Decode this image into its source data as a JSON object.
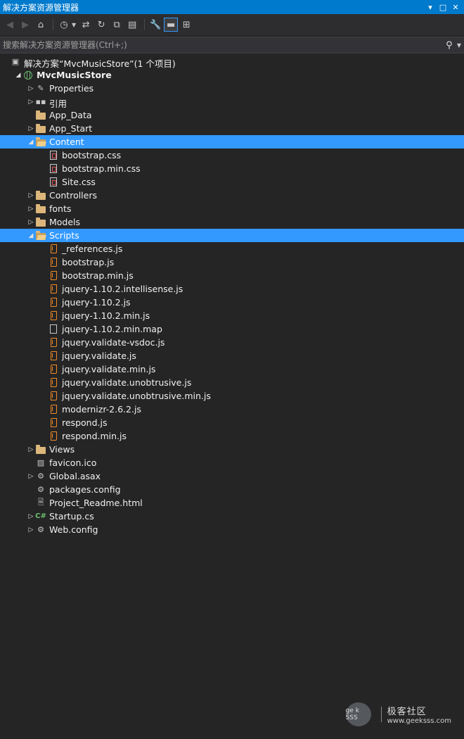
{
  "window": {
    "title": "解决方案资源管理器",
    "controls": [
      "▾",
      "□",
      "✕"
    ]
  },
  "toolbar": {
    "buttons": [
      {
        "name": "back-icon",
        "glyph": "◀",
        "disabled": true
      },
      {
        "name": "forward-icon",
        "glyph": "▶",
        "disabled": true
      },
      {
        "name": "home-icon",
        "glyph": "⌂",
        "disabled": false
      },
      {
        "name": "history-icon",
        "glyph": "◷",
        "disabled": false
      },
      {
        "name": "sync-icon",
        "glyph": "⇄",
        "disabled": false
      },
      {
        "name": "refresh-icon",
        "glyph": "↻",
        "disabled": false
      },
      {
        "name": "collapse-all-icon",
        "glyph": "⧉",
        "disabled": false
      },
      {
        "name": "show-all-files-icon",
        "glyph": "▤",
        "disabled": false
      },
      {
        "name": "properties-wrench-icon",
        "glyph": "🔧",
        "disabled": false
      },
      {
        "name": "preview-icon",
        "glyph": "▬",
        "disabled": false
      },
      {
        "name": "class-diagram-icon",
        "glyph": "⊞",
        "disabled": false
      }
    ]
  },
  "search": {
    "placeholder": "搜索解决方案资源管理器(Ctrl+;)"
  },
  "tree": [
    {
      "label": "解决方案“MvcMusicStore”(1 个项目)",
      "depth": 0,
      "expander": "none",
      "icon": "solution",
      "selected": false,
      "bold": false
    },
    {
      "label": "MvcMusicStore",
      "depth": 1,
      "expander": "open",
      "icon": "project",
      "selected": false,
      "bold": true
    },
    {
      "label": "Properties",
      "depth": 2,
      "expander": "closed",
      "icon": "wrench",
      "selected": false,
      "bold": false
    },
    {
      "label": "引用",
      "depth": 2,
      "expander": "closed",
      "icon": "references",
      "selected": false,
      "bold": false
    },
    {
      "label": "App_Data",
      "depth": 2,
      "expander": "none",
      "icon": "folder",
      "selected": false,
      "bold": false
    },
    {
      "label": "App_Start",
      "depth": 2,
      "expander": "closed",
      "icon": "folder",
      "selected": false,
      "bold": false
    },
    {
      "label": "Content",
      "depth": 2,
      "expander": "open",
      "icon": "folder-open",
      "selected": true,
      "bold": false
    },
    {
      "label": "bootstrap.css",
      "depth": 3,
      "expander": "none",
      "icon": "css",
      "selected": false,
      "bold": false
    },
    {
      "label": "bootstrap.min.css",
      "depth": 3,
      "expander": "none",
      "icon": "css",
      "selected": false,
      "bold": false
    },
    {
      "label": "Site.css",
      "depth": 3,
      "expander": "none",
      "icon": "css",
      "selected": false,
      "bold": false
    },
    {
      "label": "Controllers",
      "depth": 2,
      "expander": "closed",
      "icon": "folder",
      "selected": false,
      "bold": false
    },
    {
      "label": "fonts",
      "depth": 2,
      "expander": "closed",
      "icon": "folder",
      "selected": false,
      "bold": false
    },
    {
      "label": "Models",
      "depth": 2,
      "expander": "closed",
      "icon": "folder",
      "selected": false,
      "bold": false
    },
    {
      "label": "Scripts",
      "depth": 2,
      "expander": "open",
      "icon": "folder-open",
      "selected": true,
      "bold": false
    },
    {
      "label": "_references.js",
      "depth": 3,
      "expander": "none",
      "icon": "js",
      "selected": false,
      "bold": false
    },
    {
      "label": "bootstrap.js",
      "depth": 3,
      "expander": "none",
      "icon": "js",
      "selected": false,
      "bold": false
    },
    {
      "label": "bootstrap.min.js",
      "depth": 3,
      "expander": "none",
      "icon": "js",
      "selected": false,
      "bold": false
    },
    {
      "label": "jquery-1.10.2.intellisense.js",
      "depth": 3,
      "expander": "none",
      "icon": "js",
      "selected": false,
      "bold": false
    },
    {
      "label": "jquery-1.10.2.js",
      "depth": 3,
      "expander": "none",
      "icon": "js",
      "selected": false,
      "bold": false
    },
    {
      "label": "jquery-1.10.2.min.js",
      "depth": 3,
      "expander": "none",
      "icon": "js",
      "selected": false,
      "bold": false
    },
    {
      "label": "jquery-1.10.2.min.map",
      "depth": 3,
      "expander": "none",
      "icon": "file",
      "selected": false,
      "bold": false
    },
    {
      "label": "jquery.validate-vsdoc.js",
      "depth": 3,
      "expander": "none",
      "icon": "js",
      "selected": false,
      "bold": false
    },
    {
      "label": "jquery.validate.js",
      "depth": 3,
      "expander": "none",
      "icon": "js",
      "selected": false,
      "bold": false
    },
    {
      "label": "jquery.validate.min.js",
      "depth": 3,
      "expander": "none",
      "icon": "js",
      "selected": false,
      "bold": false
    },
    {
      "label": "jquery.validate.unobtrusive.js",
      "depth": 3,
      "expander": "none",
      "icon": "js",
      "selected": false,
      "bold": false
    },
    {
      "label": "jquery.validate.unobtrusive.min.js",
      "depth": 3,
      "expander": "none",
      "icon": "js",
      "selected": false,
      "bold": false
    },
    {
      "label": "modernizr-2.6.2.js",
      "depth": 3,
      "expander": "none",
      "icon": "js",
      "selected": false,
      "bold": false
    },
    {
      "label": "respond.js",
      "depth": 3,
      "expander": "none",
      "icon": "js",
      "selected": false,
      "bold": false
    },
    {
      "label": "respond.min.js",
      "depth": 3,
      "expander": "none",
      "icon": "js",
      "selected": false,
      "bold": false
    },
    {
      "label": "Views",
      "depth": 2,
      "expander": "closed",
      "icon": "folder",
      "selected": false,
      "bold": false
    },
    {
      "label": "favicon.ico",
      "depth": 2,
      "expander": "none",
      "icon": "image",
      "selected": false,
      "bold": false
    },
    {
      "label": "Global.asax",
      "depth": 2,
      "expander": "closed",
      "icon": "asax",
      "selected": false,
      "bold": false
    },
    {
      "label": "packages.config",
      "depth": 2,
      "expander": "none",
      "icon": "config",
      "selected": false,
      "bold": false
    },
    {
      "label": "Project_Readme.html",
      "depth": 2,
      "expander": "none",
      "icon": "html",
      "selected": false,
      "bold": false
    },
    {
      "label": "Startup.cs",
      "depth": 2,
      "expander": "closed",
      "icon": "csharp",
      "selected": false,
      "bold": false
    },
    {
      "label": "Web.config",
      "depth": 2,
      "expander": "closed",
      "icon": "config",
      "selected": false,
      "bold": false
    }
  ],
  "watermark": {
    "logo_text": "ge k SSS",
    "name": "极客社区",
    "url": "www.geeksss.com"
  },
  "colors": {
    "titlebar": "#007acc",
    "selection": "#3399ff",
    "background": "#252526",
    "js_icon": "#f08a24",
    "folder_icon": "#dcb67a"
  }
}
